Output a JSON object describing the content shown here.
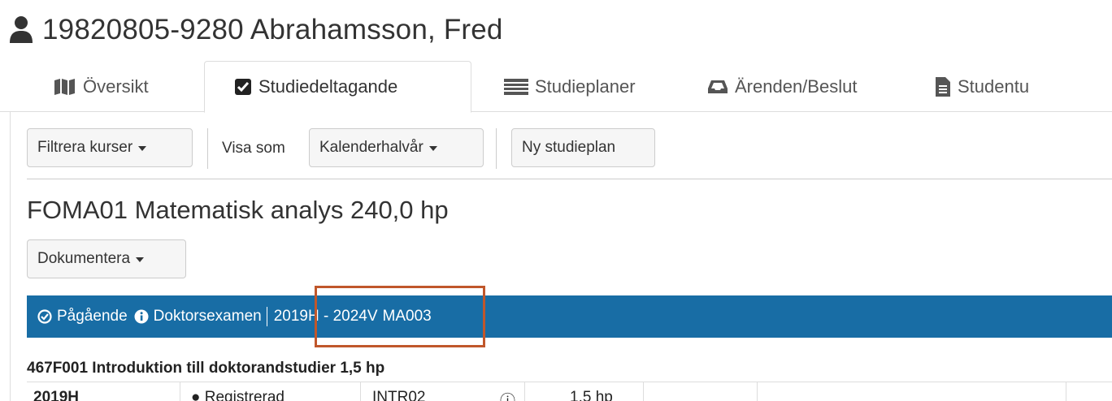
{
  "student": {
    "title": "19820805-9280 Abrahamsson, Fred",
    "icon": "user-icon"
  },
  "tabs": [
    {
      "label": "Översikt",
      "icon": "map-icon",
      "active": false
    },
    {
      "label": "Studiedeltagande",
      "icon": "check-square-icon",
      "active": true
    },
    {
      "label": "Studieplaner",
      "icon": "list-icon",
      "active": false
    },
    {
      "label": "Ärenden/Beslut",
      "icon": "inbox-icon",
      "active": false
    },
    {
      "label": "Studentu",
      "icon": "file-icon",
      "active": false
    }
  ],
  "toolbar": {
    "filter_label": "Filtrera kurser",
    "visa_label": "Visa som",
    "kalender_label": "Kalenderhalvår",
    "ny_label": "Ny studieplan"
  },
  "program": {
    "title": "FOMA01 Matematisk analys 240,0 hp",
    "dokumentera_label": "Dokumentera"
  },
  "status": {
    "state": "Pågående",
    "exam": "Doktorsexamen",
    "period": "2019H - 2024V",
    "code": "MA003",
    "bar_color": "#186da5",
    "highlight_color": "#c0572b"
  },
  "course": {
    "title": "467F001 Introduktion till doktorandstudier 1,5 hp",
    "row": {
      "term": "2019H",
      "status": "Registrerad",
      "code": "INTR02",
      "hp": "1,5 hp"
    }
  }
}
